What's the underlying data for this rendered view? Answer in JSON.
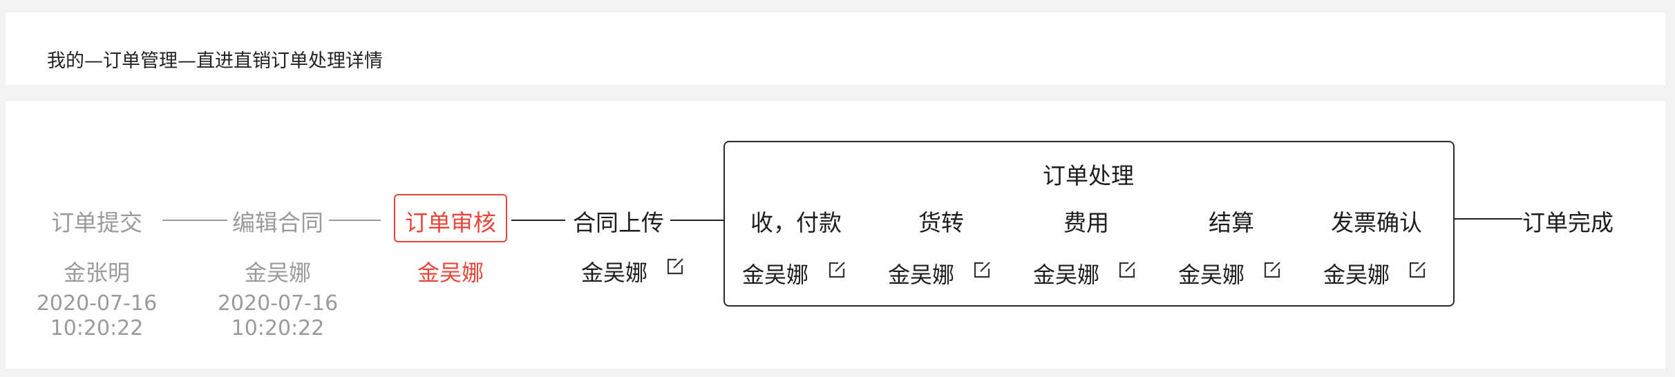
{
  "breadcrumb": {
    "text": "我的—订单管理—直进直销订单处理详情"
  },
  "colors": {
    "active": "#e8463b",
    "done": "#9a9a9a",
    "pending": "#1d1d1d"
  },
  "workflow": {
    "steps": [
      {
        "label": "订单提交",
        "user": "金张明",
        "date": "2020-07-16",
        "time": "10:20:22",
        "status": "done"
      },
      {
        "label": "编辑合同",
        "user": "金吴娜",
        "date": "2020-07-16",
        "time": "10:20:22",
        "status": "done"
      },
      {
        "label": "订单审核",
        "user": "金吴娜",
        "status": "active"
      },
      {
        "label": "合同上传",
        "user": "金吴娜",
        "status": "pending"
      }
    ],
    "group": {
      "title": "订单处理",
      "steps": [
        {
          "label": "收，付款",
          "user": "金吴娜"
        },
        {
          "label": "货转",
          "user": "金吴娜"
        },
        {
          "label": "费用",
          "user": "金吴娜"
        },
        {
          "label": "结算",
          "user": "金吴娜"
        },
        {
          "label": "发票确认",
          "user": "金吴娜"
        }
      ]
    },
    "final_step": {
      "label": "订单完成"
    },
    "edit_icon": "edit-icon"
  }
}
